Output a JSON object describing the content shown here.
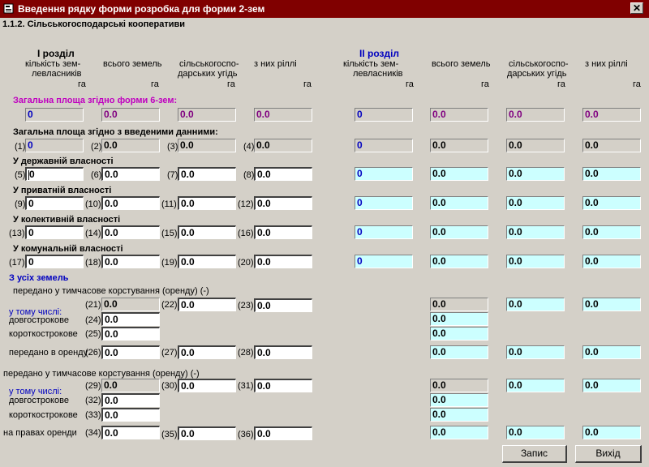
{
  "window": {
    "title": "Введення рядку форми розробка для форми 2-зем",
    "close_label": "✕"
  },
  "subtitle": "1.1.2. Сільськогосподарські кооперативи",
  "section1": "І розділ",
  "section2": "ІІ розділ",
  "col_headers": {
    "c1a": "кількість зем-",
    "c1b": "левласників",
    "c2": "всього земель",
    "c3a": "сільськогоспо-",
    "c3b": "дарських угідь",
    "c4": "з них ріллі",
    "unit": "га"
  },
  "groups": {
    "g1": "Загальна площа згідно  форми 6-зем:",
    "g2": "Загальна площа згідно  з введеними данними:",
    "g3": "У державній власності",
    "g4": "У приватній власності",
    "g5": "У колективній власності",
    "g6": "У комунальній власності",
    "g7": "З усіх земель"
  },
  "sub": {
    "lease1": "передано у тимчасове корстування (оренду)  (-)",
    "incl1": "у тому числі:",
    "long1": "довгострокове",
    "short1": "короткострокове",
    "lease_out": "передано в оренду",
    "lease2": "передано у тимчасове корстування (оренду)  (-)",
    "incl2": "у тому числі:",
    "long2": "довгострокове",
    "short2": "короткострокове",
    "rights": "на правах оренди"
  },
  "nums": {
    "n1": "(1)",
    "n2": "(2)",
    "n3": "(3)",
    "n4": "(4)",
    "n5": "(5)",
    "n6": "(6)",
    "n7": "(7)",
    "n8": "(8)",
    "n9": "(9)",
    "n10": "(10)",
    "n11": "(11)",
    "n12": "(12)",
    "n13": "(13)",
    "n14": "(14)",
    "n15": "(15)",
    "n16": "(16)",
    "n17": "(17)",
    "n18": "(18)",
    "n19": "(19)",
    "n20": "(20)",
    "n21": "(21)",
    "n22": "(22)",
    "n23": "(23)",
    "n24": "(24)",
    "n25": "(25)",
    "n26": "(26)",
    "n27": "(27)",
    "n28": "(28)",
    "n29": "(29)",
    "n30": "(30)",
    "n31": "(31)",
    "n32": "(32)",
    "n33": "(33)",
    "n34": "(34)",
    "n35": "(35)",
    "n36": "(36)"
  },
  "values": {
    "zero_int": "0",
    "zero_dec": "0.0"
  },
  "buttons": {
    "save": "Запис",
    "exit": "Вихід"
  },
  "colors": {
    "titlebar": "#800000",
    "form_bg": "#d4d0c8",
    "section2_fields": "#ccffff",
    "heading_blue": "#0000c0",
    "heading_magenta": "#c000c0"
  }
}
